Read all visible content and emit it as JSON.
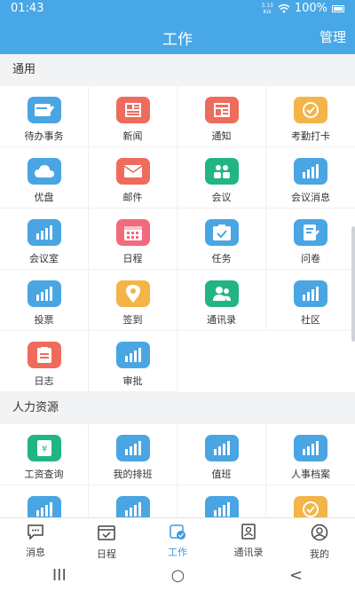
{
  "status": {
    "time": "01:43",
    "net_top": "3.13",
    "net_bottom": "K/s",
    "battery": "100%"
  },
  "header": {
    "title": "工作",
    "manage": "管理"
  },
  "sections": [
    {
      "title": "通用",
      "items": [
        {
          "label": "待办事务",
          "icon": "todo-card-icon",
          "color": "#4aa5e3"
        },
        {
          "label": "新闻",
          "icon": "newspaper-icon",
          "color": "#ef6b5c"
        },
        {
          "label": "通知",
          "icon": "notice-icon",
          "color": "#ef6b5c"
        },
        {
          "label": "考勤打卡",
          "icon": "clock-in-icon",
          "color": "#f3b448"
        },
        {
          "label": "优盘",
          "icon": "cloud-icon",
          "color": "#4aa5e3"
        },
        {
          "label": "邮件",
          "icon": "mail-icon",
          "color": "#ef6b5c"
        },
        {
          "label": "会议",
          "icon": "meeting-people-icon",
          "color": "#21b582"
        },
        {
          "label": "会议消息",
          "icon": "chart-icon",
          "color": "#4aa5e3"
        },
        {
          "label": "会议室",
          "icon": "chart-icon",
          "color": "#4aa5e3"
        },
        {
          "label": "日程",
          "icon": "calendar-icon",
          "color": "#f16a7d"
        },
        {
          "label": "任务",
          "icon": "task-icon",
          "color": "#4aa5e3"
        },
        {
          "label": "问卷",
          "icon": "questionnaire-icon",
          "color": "#4aa5e3"
        },
        {
          "label": "投票",
          "icon": "chart-icon",
          "color": "#4aa5e3"
        },
        {
          "label": "签到",
          "icon": "location-icon",
          "color": "#f3b448"
        },
        {
          "label": "通讯录",
          "icon": "contacts-icon",
          "color": "#21b582"
        },
        {
          "label": "社区",
          "icon": "chart-icon",
          "color": "#4aa5e3"
        },
        {
          "label": "日志",
          "icon": "log-icon",
          "color": "#ef6b5c"
        },
        {
          "label": "审批",
          "icon": "chart-icon",
          "color": "#4aa5e3"
        }
      ]
    },
    {
      "title": "人力资源",
      "items": [
        {
          "label": "工资查询",
          "icon": "salary-icon",
          "color": "#21b582"
        },
        {
          "label": "我的排班",
          "icon": "chart-icon",
          "color": "#4aa5e3"
        },
        {
          "label": "值班",
          "icon": "chart-icon",
          "color": "#4aa5e3"
        },
        {
          "label": "人事档案",
          "icon": "chart-icon",
          "color": "#4aa5e3"
        },
        {
          "label": "",
          "icon": "chart-icon",
          "color": "#4aa5e3"
        },
        {
          "label": "",
          "icon": "chart-icon",
          "color": "#4aa5e3"
        },
        {
          "label": "",
          "icon": "chart-icon",
          "color": "#4aa5e3"
        },
        {
          "label": "",
          "icon": "clock-in-icon",
          "color": "#f3b448"
        }
      ]
    }
  ],
  "tabs": [
    {
      "label": "消息",
      "icon": "message-icon",
      "active": false
    },
    {
      "label": "日程",
      "icon": "calendar-icon",
      "active": false
    },
    {
      "label": "工作",
      "icon": "work-icon",
      "active": true
    },
    {
      "label": "通讯录",
      "icon": "address-book-icon",
      "active": false
    },
    {
      "label": "我的",
      "icon": "profile-icon",
      "active": false
    }
  ],
  "nav": {
    "recent": "III",
    "home": "○",
    "back": "<"
  }
}
